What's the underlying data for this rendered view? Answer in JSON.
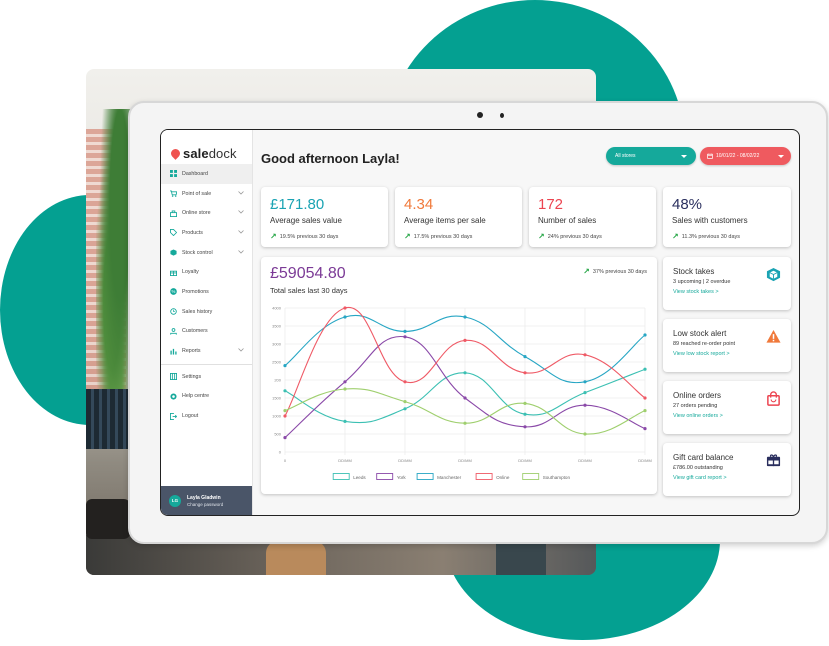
{
  "brand": {
    "name_bold": "sale",
    "name_rest": "dock",
    "accent": "#15a99b",
    "logo_color": "#ef5350"
  },
  "sidebar": {
    "items": [
      {
        "label": "Dashboard",
        "icon": "grid-icon",
        "active": true,
        "expandable": false
      },
      {
        "label": "Point of sale",
        "icon": "cart-icon",
        "expandable": true
      },
      {
        "label": "Online store",
        "icon": "store-icon",
        "expandable": true
      },
      {
        "label": "Products",
        "icon": "tag-icon",
        "expandable": true
      },
      {
        "label": "Stock control",
        "icon": "box-icon",
        "expandable": true
      },
      {
        "label": "Loyalty",
        "icon": "gift-icon",
        "expandable": false
      },
      {
        "label": "Promotions",
        "icon": "percent-icon",
        "expandable": false
      },
      {
        "label": "Sales history",
        "icon": "history-icon",
        "expandable": false
      },
      {
        "label": "Customers",
        "icon": "user-icon",
        "expandable": false
      },
      {
        "label": "Reports",
        "icon": "bar-chart-icon",
        "expandable": true
      }
    ],
    "bottom_items": [
      {
        "label": "Settings",
        "icon": "settings-icon"
      },
      {
        "label": "Help centre",
        "icon": "help-icon"
      },
      {
        "label": "Logout",
        "icon": "logout-icon"
      }
    ],
    "user": {
      "initials": "LG",
      "name": "Layla Gladwin",
      "action": "Change password"
    }
  },
  "header": {
    "greeting": "Good afternoon Layla!",
    "store_filter": "All stores",
    "date_range": "10/01/22 - 08/02/22"
  },
  "stats": [
    {
      "value": "£171.80",
      "label": "Average sales value",
      "trend": "19.5% previous 30 days",
      "color": "#1aa3b3"
    },
    {
      "value": "4.34",
      "label": "Average items per sale",
      "trend": "17.5% previous 30 days",
      "color": "#f0793a"
    },
    {
      "value": "172",
      "label": "Number of sales",
      "trend": "24% previous 30 days",
      "color": "#ec4450"
    },
    {
      "value": "48%",
      "label": "Sales with customers",
      "trend": "11.3% previous 30 days",
      "color": "#2a2f5e"
    }
  ],
  "total_sales": {
    "value": "£59054.80",
    "label": "Total sales last 30 days",
    "trend": "37% previous 30 days"
  },
  "chart_data": {
    "type": "line",
    "title": "Total sales last 30 days",
    "x": [
      "0",
      "DD/MM",
      "DD/MM",
      "DD/MM",
      "DD/MM",
      "DD/MM",
      "DD/MM"
    ],
    "yticks": [
      "4000",
      "3500",
      "3000",
      "2500",
      "200",
      "1500",
      "1000",
      "500",
      "0"
    ],
    "ylim": [
      0,
      4000
    ],
    "grid": true,
    "legend_position": "bottom",
    "series": [
      {
        "name": "Leeds",
        "color": "#3cc0b3",
        "values": [
          1700,
          850,
          1200,
          2200,
          1050,
          1650,
          2300
        ]
      },
      {
        "name": "York",
        "color": "#8a49a8",
        "values": [
          400,
          1950,
          3200,
          1500,
          700,
          1300,
          650
        ]
      },
      {
        "name": "Manchester",
        "color": "#27a6c4",
        "values": [
          2400,
          3750,
          3350,
          3750,
          2650,
          1950,
          3250
        ]
      },
      {
        "name": "Online",
        "color": "#ef5a66",
        "values": [
          1000,
          4000,
          1950,
          3100,
          2200,
          2700,
          1500
        ]
      },
      {
        "name": "Southampton",
        "color": "#9fcf6e",
        "values": [
          1150,
          1750,
          1400,
          800,
          1350,
          500,
          1150
        ]
      }
    ]
  },
  "side_cards": [
    {
      "title": "Stock takes",
      "desc": "3 upcoming | 2 overdue",
      "link": "View stock takes >",
      "icon": "box-icon",
      "icon_color": "#1aa3b3"
    },
    {
      "title": "Low stock alert",
      "desc": "89 reached re-order point",
      "link": "View low stock report >",
      "icon": "warning-icon",
      "icon_color": "#f0793a"
    },
    {
      "title": "Online orders",
      "desc": "27 orders pending",
      "link": "View online orders >",
      "icon": "shopping-bag-icon",
      "icon_color": "#ec4450"
    },
    {
      "title": "Gift card balance",
      "desc": "£786.00 outstanding",
      "link": "View gift card report >",
      "icon": "gift-card-icon",
      "icon_color": "#2a2f5e"
    }
  ]
}
